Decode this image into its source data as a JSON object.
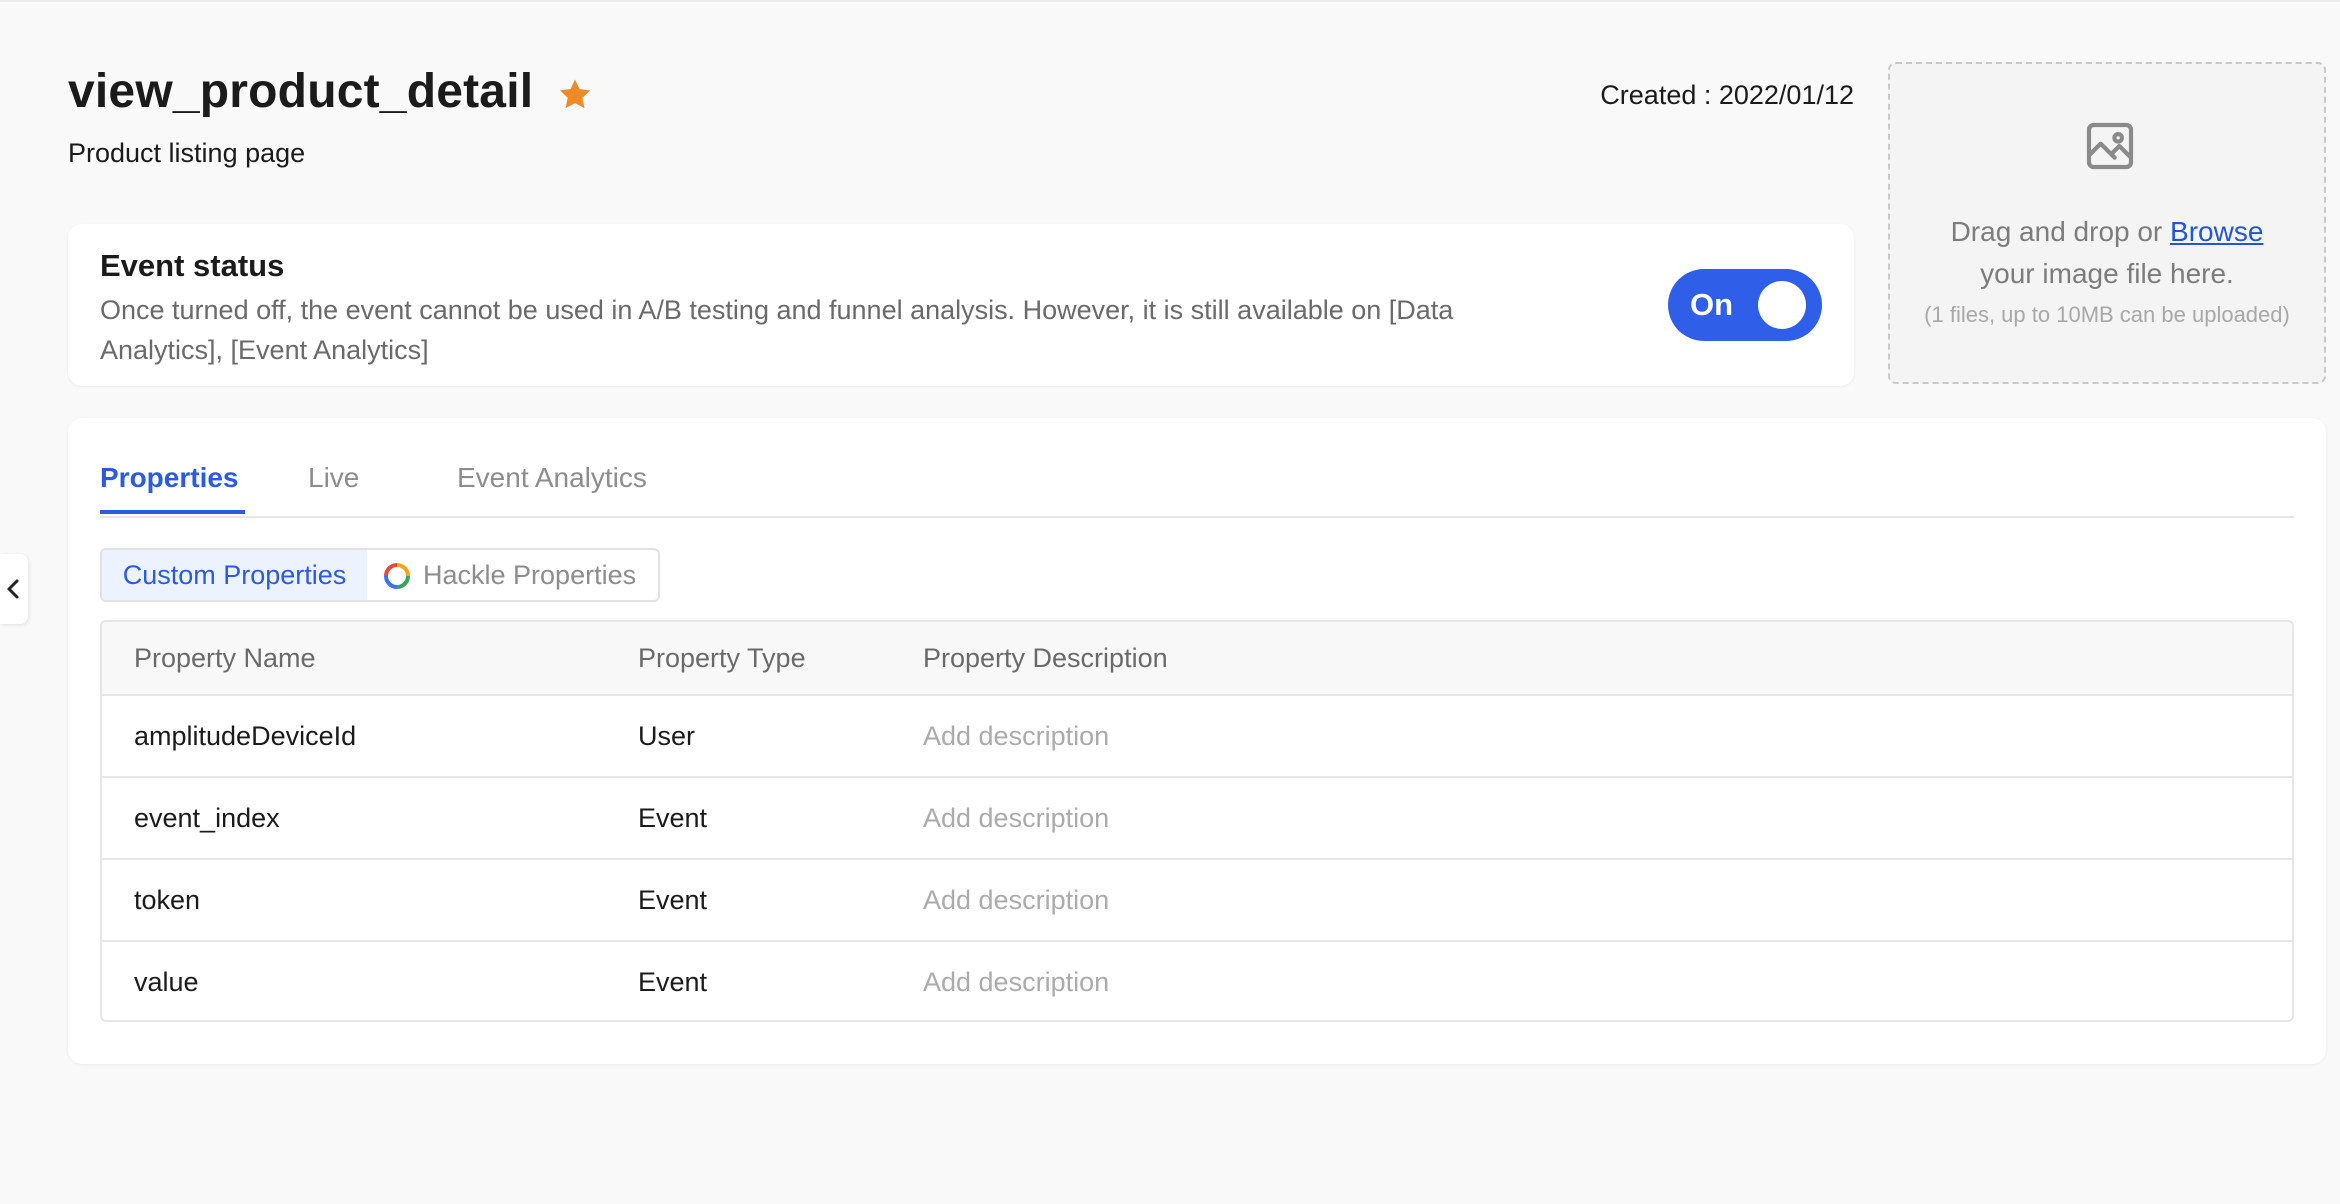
{
  "header": {
    "title": "view_product_detail",
    "subtitle": "Product listing page",
    "created_label": "Created : 2022/01/12",
    "star_color": "#f08a24"
  },
  "upload": {
    "text_before_link": "Drag and drop or ",
    "browse_label": "Browse",
    "text_line2": "your image file here.",
    "hint": "(1 files, up to 10MB can be uploaded)",
    "icon": "image-icon"
  },
  "status": {
    "title": "Event status",
    "description": "Once turned off, the event cannot be used in A/B testing and funnel analysis. However, it is still available on [Data Analytics], [Event Analytics]",
    "toggle_label": "On",
    "toggle_on": true,
    "accent_color": "#2f5fe8"
  },
  "tabs": [
    {
      "label": "Properties",
      "active": true
    },
    {
      "label": "Live",
      "active": false
    },
    {
      "label": "Event Analytics",
      "active": false
    }
  ],
  "segments": {
    "custom": "Custom Properties",
    "hackle": "Hackle Properties"
  },
  "table": {
    "headers": [
      "Property Name",
      "Property Type",
      "Property Description"
    ],
    "rows": [
      {
        "name": "amplitudeDeviceId",
        "type": "User",
        "description": "Add description"
      },
      {
        "name": "event_index",
        "type": "Event",
        "description": "Add description"
      },
      {
        "name": "token",
        "type": "Event",
        "description": "Add description"
      },
      {
        "name": "value",
        "type": "Event",
        "description": "Add description"
      }
    ]
  }
}
